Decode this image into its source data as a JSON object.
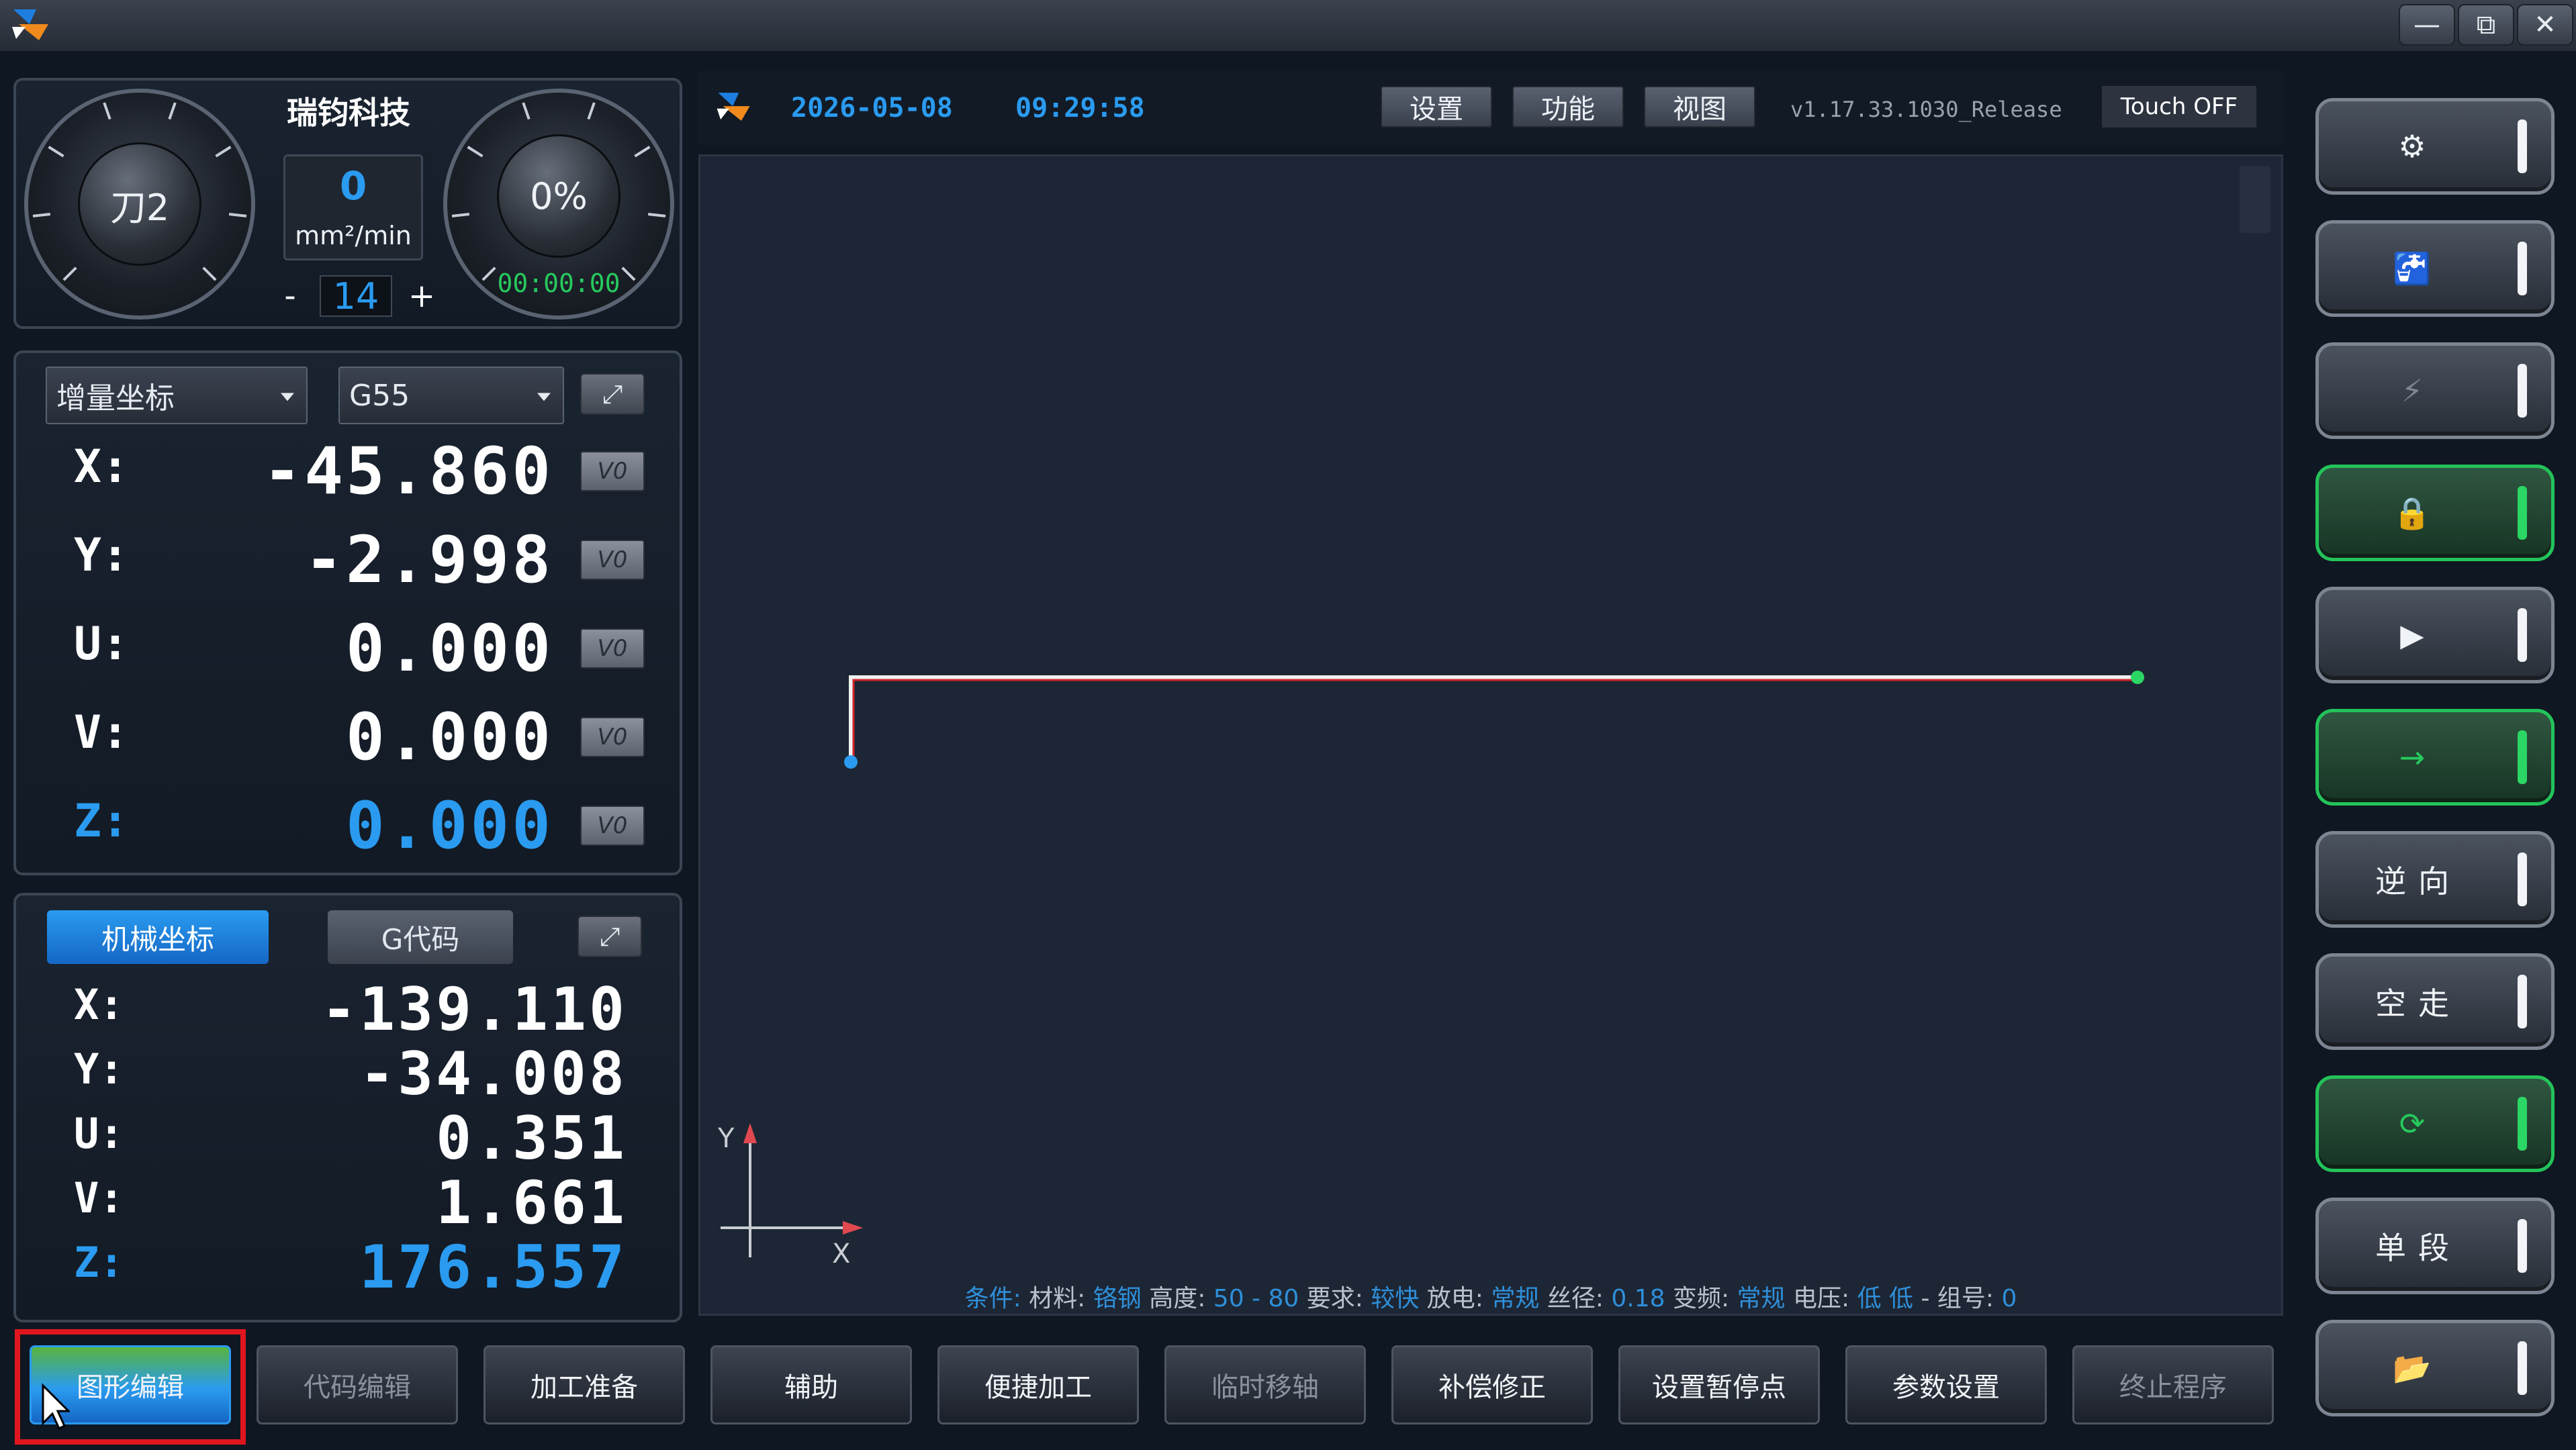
{
  "window": {
    "controls": {
      "minimize": "—",
      "restore": "⧉",
      "close": "✕"
    }
  },
  "status_panel": {
    "brand": "瑞钧科技",
    "left_dial": "刀2",
    "speed_value": "0",
    "speed_unit": "mm²/min",
    "stepper_minus": "-",
    "stepper_value": "14",
    "stepper_plus": "+",
    "right_dial": "0%",
    "timer": "00:00:00"
  },
  "coord_panel": {
    "mode": "增量坐标",
    "workpiece": "G55",
    "rows": [
      {
        "label": "X:",
        "value": "-45.860",
        "button": "V0"
      },
      {
        "label": "Y:",
        "value": "-2.998",
        "button": "V0"
      },
      {
        "label": "U:",
        "value": "0.000",
        "button": "V0"
      },
      {
        "label": "V:",
        "value": "0.000",
        "button": "V0"
      },
      {
        "label": "Z:",
        "value": "0.000",
        "button": "V0"
      }
    ]
  },
  "machine_panel": {
    "tab_active": "机械坐标",
    "tab_inactive": "G代码",
    "rows": [
      {
        "label": "X:",
        "value": "-139.110"
      },
      {
        "label": "Y:",
        "value": "-34.008"
      },
      {
        "label": "U:",
        "value": "0.351"
      },
      {
        "label": "V:",
        "value": "1.661"
      },
      {
        "label": "Z:",
        "value": "176.557"
      }
    ]
  },
  "header": {
    "date": "2026-05-08",
    "time": "09:29:58",
    "btn_settings": "设置",
    "btn_function": "功能",
    "btn_view": "视图",
    "version": "v1.17.33.1030_Release",
    "touch": "Touch OFF"
  },
  "viewport": {
    "axis_y": "Y",
    "axis_x": "X",
    "status": [
      {
        "text": "条件:",
        "color": "#2e8fd9"
      },
      {
        "text": " 材料:",
        "color": "#b9c1cc"
      },
      {
        "text": " 铬钢",
        "color": "#2e8fd9"
      },
      {
        "text": " 高度:",
        "color": "#b9c1cc"
      },
      {
        "text": " 50 - 80",
        "color": "#2e8fd9"
      },
      {
        "text": " 要求:",
        "color": "#b9c1cc"
      },
      {
        "text": " 较快",
        "color": "#2e8fd9"
      },
      {
        "text": " 放电:",
        "color": "#b9c1cc"
      },
      {
        "text": " 常规",
        "color": "#2e8fd9"
      },
      {
        "text": " 丝径:",
        "color": "#b9c1cc"
      },
      {
        "text": " 0.18",
        "color": "#2e8fd9"
      },
      {
        "text": " 变频:",
        "color": "#b9c1cc"
      },
      {
        "text": " 常规",
        "color": "#2e8fd9"
      },
      {
        "text": " 电压:",
        "color": "#b9c1cc"
      },
      {
        "text": " 低 低",
        "color": "#2e8fd9"
      },
      {
        "text": " - 组号:",
        "color": "#b9c1cc"
      },
      {
        "text": " 0",
        "color": "#2e8fd9"
      }
    ]
  },
  "side_buttons": {
    "reverse": "逆向",
    "dry_run": "空走",
    "single": "单段"
  },
  "bottom_bar": [
    {
      "label": "图形编辑"
    },
    {
      "label": "代码编辑"
    },
    {
      "label": "加工准备"
    },
    {
      "label": "辅助"
    },
    {
      "label": "便捷加工"
    },
    {
      "label": "临时移轴"
    },
    {
      "label": "补偿修正"
    },
    {
      "label": "设置暂停点"
    },
    {
      "label": "参数设置"
    },
    {
      "label": "终止程序"
    }
  ],
  "colors": {
    "accent_blue": "#2a9bf0",
    "active_green": "#23c35a",
    "highlight_red": "#e0161e"
  }
}
